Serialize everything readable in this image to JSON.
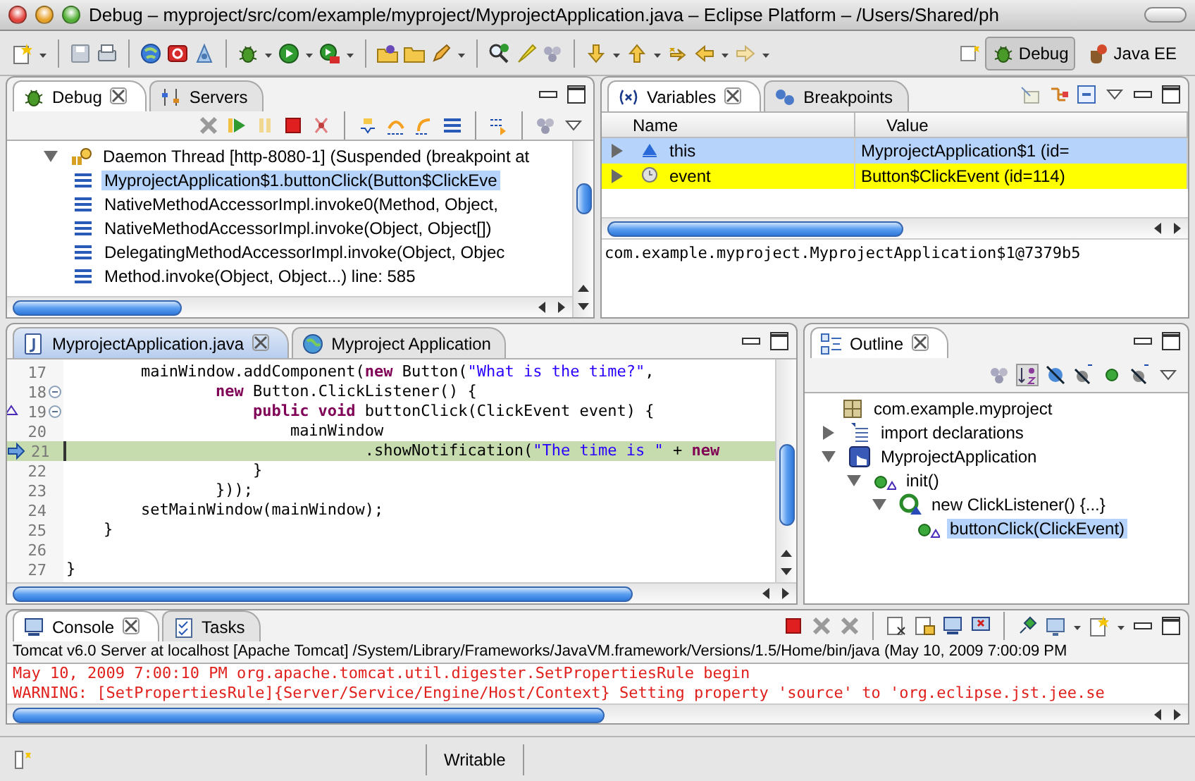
{
  "window": {
    "title": "Debug – myproject/src/com/example/myproject/MyprojectApplication.java – Eclipse Platform – /Users/Shared/ph"
  },
  "perspectives": [
    {
      "label": "Debug",
      "selected": true
    },
    {
      "label": "Java EE",
      "selected": false
    }
  ],
  "debug_view": {
    "tabs": [
      {
        "label": "Debug",
        "selected": true
      },
      {
        "label": "Servers",
        "selected": false
      }
    ],
    "thread": {
      "label": "Daemon Thread [http-8080-1] (Suspended (breakpoint at",
      "expanded": true
    },
    "frames": [
      {
        "label": "MyprojectApplication$1.buttonClick(Button$ClickEve",
        "selected": true
      },
      {
        "label": "NativeMethodAccessorImpl.invoke0(Method, Object,",
        "selected": false
      },
      {
        "label": "NativeMethodAccessorImpl.invoke(Object, Object[])",
        "selected": false
      },
      {
        "label": "DelegatingMethodAccessorImpl.invoke(Object, Objec",
        "selected": false
      },
      {
        "label": "Method.invoke(Object, Object...) line: 585",
        "selected": false
      }
    ]
  },
  "variables_view": {
    "tabs": [
      {
        "label": "Variables",
        "selected": true
      },
      {
        "label": "Breakpoints",
        "selected": false
      }
    ],
    "columns": [
      "Name",
      "Value"
    ],
    "rows": [
      {
        "kind": "field",
        "name": "this",
        "value": "MyprojectApplication$1 (id=",
        "selected": true,
        "changed": false,
        "expanded": false
      },
      {
        "kind": "local",
        "name": "event",
        "value": "Button$ClickEvent (id=114)",
        "selected": false,
        "changed": true,
        "expanded": false
      }
    ],
    "detail": "com.example.myproject.MyprojectApplication$1@7379b5"
  },
  "editor": {
    "tabs": [
      {
        "label": "MyprojectApplication.java",
        "kind": "java",
        "selected": true
      },
      {
        "label": "Myproject Application",
        "kind": "browser",
        "selected": false
      }
    ],
    "lines": [
      {
        "number": "17",
        "current": false,
        "fold": false,
        "overrides": false,
        "segments": [
          {
            "kind": "plain",
            "text": "        mainWindow.addComponent("
          },
          {
            "kind": "keyword",
            "text": "new"
          },
          {
            "kind": "plain",
            "text": " Button("
          },
          {
            "kind": "string",
            "text": "\"What is the time?\""
          },
          {
            "kind": "plain",
            "text": ","
          }
        ]
      },
      {
        "number": "18",
        "current": false,
        "fold": true,
        "overrides": false,
        "segments": [
          {
            "kind": "keyword",
            "text": "                new"
          },
          {
            "kind": "plain",
            "text": " Button.ClickListener() {"
          }
        ]
      },
      {
        "number": "19",
        "current": false,
        "fold": true,
        "overrides": true,
        "segments": [
          {
            "kind": "keyword",
            "text": "                    public void"
          },
          {
            "kind": "plain",
            "text": " buttonClick(ClickEvent event) {"
          }
        ]
      },
      {
        "number": "20",
        "current": false,
        "fold": false,
        "overrides": false,
        "segments": [
          {
            "kind": "plain",
            "text": "                        mainWindow"
          }
        ]
      },
      {
        "number": "21",
        "current": true,
        "fold": false,
        "overrides": false,
        "segments": [
          {
            "kind": "plain",
            "text": "                                .showNotification("
          },
          {
            "kind": "string",
            "text": "\"The time is \""
          },
          {
            "kind": "plain",
            "text": " + "
          },
          {
            "kind": "keyword",
            "text": "new"
          }
        ]
      },
      {
        "number": "22",
        "current": false,
        "fold": false,
        "overrides": false,
        "segments": [
          {
            "kind": "plain",
            "text": "                    }"
          }
        ]
      },
      {
        "number": "23",
        "current": false,
        "fold": false,
        "overrides": false,
        "segments": [
          {
            "kind": "plain",
            "text": "                }));"
          }
        ]
      },
      {
        "number": "24",
        "current": false,
        "fold": false,
        "overrides": false,
        "segments": [
          {
            "kind": "plain",
            "text": "        setMainWindow(mainWindow);"
          }
        ]
      },
      {
        "number": "25",
        "current": false,
        "fold": false,
        "overrides": false,
        "segments": [
          {
            "kind": "plain",
            "text": "    }"
          }
        ]
      },
      {
        "number": "26",
        "current": false,
        "fold": false,
        "overrides": false
      },
      {
        "number": "27",
        "current": false,
        "fold": false,
        "overrides": false,
        "segments": [
          {
            "kind": "plain",
            "text": "}"
          }
        ]
      }
    ]
  },
  "outline": {
    "tabs": [
      {
        "label": "Outline",
        "selected": true
      }
    ],
    "items": [
      {
        "kind": "package",
        "label": "com.example.myproject",
        "selected": false
      },
      {
        "kind": "imports",
        "label": "import declarations",
        "selected": false,
        "expanded": false
      },
      {
        "kind": "class",
        "label": "MyprojectApplication",
        "selected": false,
        "expanded": true,
        "children": [
          {
            "kind": "method",
            "label": "init()",
            "selected": false,
            "expanded": true,
            "children": [
              {
                "kind": "anonymous",
                "label": "new ClickListener() {...}",
                "selected": false,
                "expanded": true,
                "children": [
                  {
                    "kind": "method",
                    "label": "buttonClick(ClickEvent)",
                    "selected": true
                  }
                ]
              }
            ]
          }
        ]
      }
    ]
  },
  "console": {
    "tabs": [
      {
        "label": "Console",
        "selected": true
      },
      {
        "label": "Tasks",
        "selected": false
      }
    ],
    "process": "Tomcat v6.0 Server at localhost [Apache Tomcat] /System/Library/Frameworks/JavaVM.framework/Versions/1.5/Home/bin/java (May 10, 2009 7:00:09 PM",
    "output": [
      "May 10, 2009 7:00:10 PM org.apache.tomcat.util.digester.SetPropertiesRule begin",
      "WARNING: [SetPropertiesRule]{Server/Service/Engine/Host/Context} Setting property 'source' to 'org.eclipse.jst.jee.se"
    ]
  },
  "status_bar": {
    "mode": "Writable"
  }
}
